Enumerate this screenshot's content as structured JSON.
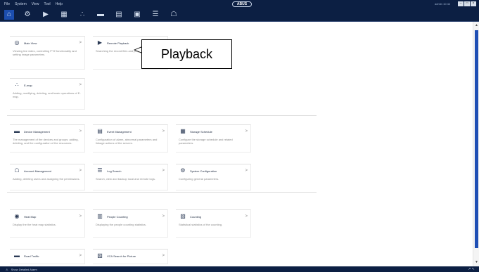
{
  "menu": [
    "File",
    "System",
    "View",
    "Tool",
    "Help"
  ],
  "brand": "ABUS",
  "user": "admin 10:44",
  "window_buttons": [
    "–",
    "□",
    "×"
  ],
  "toolbar": [
    "⌂",
    "⚙",
    "▶",
    "▦",
    "∴",
    "▬",
    "▤",
    "▣",
    "☰",
    "☖"
  ],
  "cards": [
    {
      "title": "Main View",
      "desc": "Viewing live video, controlling PTZ functionality and setting image parameters.",
      "icon": "◎",
      "icon_name": "main-view-icon"
    },
    {
      "title": "Remote Playback",
      "desc": "Searching the record files and playback.",
      "icon": "▶",
      "icon_name": "remote-playback-icon"
    },
    {
      "title": "E-map",
      "desc": "Adding, modifying, deleting, and basic operations of E-map.",
      "icon": "∴",
      "icon_name": "emap-icon"
    },
    {
      "title": "Device Management",
      "desc": "The management of the devices and groups: adding, deleting, and the configuration of the resources.",
      "icon": "▬",
      "icon_name": "device-management-icon"
    },
    {
      "title": "Event Management",
      "desc": "Configuration of alarm, abnormal parameters and linkage actions of the servers.",
      "icon": "▤",
      "icon_name": "event-management-icon"
    },
    {
      "title": "Storage Schedule",
      "desc": "Configure the storage schedule and related parameters.",
      "icon": "▦",
      "icon_name": "storage-schedule-icon"
    },
    {
      "title": "Account Management",
      "desc": "Adding, deleting users and assigning the permissions.",
      "icon": "☖",
      "icon_name": "account-management-icon"
    },
    {
      "title": "Log Search",
      "desc": "Search, view and backup local and remote logs.",
      "icon": "☰",
      "icon_name": "log-search-icon"
    },
    {
      "title": "System Configuration",
      "desc": "Configuring general parameters.",
      "icon": "⚙",
      "icon_name": "system-configuration-icon"
    },
    {
      "title": "Heat Map",
      "desc": "Display the the heat map statistics.",
      "icon": "◉",
      "icon_name": "heat-map-icon"
    },
    {
      "title": "People Counting",
      "desc": "Displaying the people counting statistics.",
      "icon": "▥",
      "icon_name": "people-counting-icon"
    },
    {
      "title": "Counting",
      "desc": "Statistical statistics of the counting.",
      "icon": "▧",
      "icon_name": "counting-icon"
    },
    {
      "title": "Road Traffic",
      "desc": "",
      "icon": "▬",
      "icon_name": "road-traffic-icon"
    },
    {
      "title": "VCA Search for Picture",
      "desc": "",
      "icon": "▨",
      "icon_name": "vca-search-icon"
    }
  ],
  "callout": {
    "text": "Playback"
  },
  "status": {
    "text": "Show Detailed Alarm",
    "right": "↗ ↖"
  },
  "colors": {
    "topbar": "#0c1f43",
    "accent": "#1f4fb4",
    "active_tab": "#1c4eaf"
  }
}
